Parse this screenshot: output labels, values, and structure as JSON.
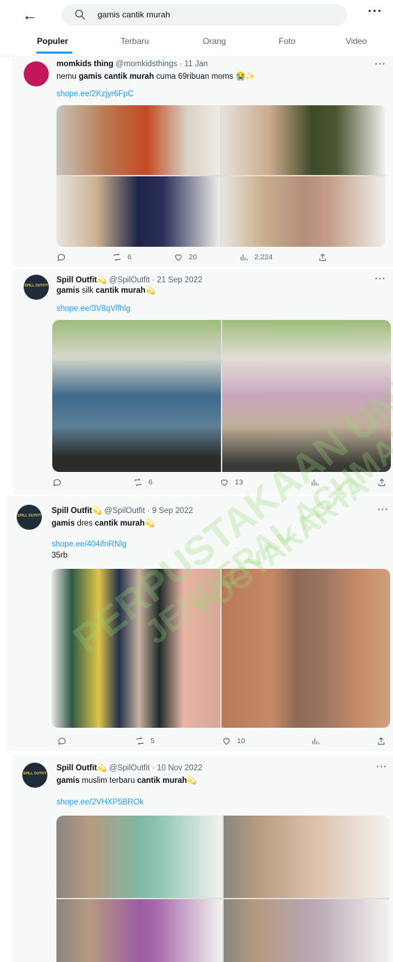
{
  "search": {
    "query": "gamis cantik murah"
  },
  "tabs": [
    "Populer",
    "Terbaru",
    "Orang",
    "Foto",
    "Video"
  ],
  "posts": [
    {
      "name": "momkids thing",
      "handle": "@momkidsthings",
      "date": "· 11 Jan",
      "text_pre": "nemu ",
      "text_bold": "gamis cantik murah",
      "text_post": " cuma 69ribuan moms 😭✨",
      "link": "shope.ee/2Kzjyr6FpC",
      "replies": "",
      "retweets": "6",
      "likes": "20",
      "views": "2.224"
    },
    {
      "name": "Spill Outfit",
      "badge": "💫",
      "handle": "@SpilOutfit",
      "date": "· 21 Sep 2022",
      "text": [
        {
          "b": "gamis"
        },
        {
          "t": " silk "
        },
        {
          "b": "cantik murah"
        },
        {
          "t": "💫"
        }
      ],
      "link": "shope.ee/3V8qVlfhlg",
      "retweets": "6",
      "likes": "13"
    },
    {
      "name": "Spill Outfit",
      "badge": "💫",
      "handle": "@SpilOutfit",
      "date": "· 9 Sep 2022",
      "text_b1": "gamis",
      "text_t1": " dres ",
      "text_b2": "cantik murah",
      "text_t2": "💫",
      "link": "shope.ee/404ifnRNlg",
      "extra": "35rb",
      "retweets": "5",
      "likes": "10"
    },
    {
      "name": "Spill Outfit",
      "badge": "💫",
      "handle": "@SpilOutfit",
      "date": "· 10 Nov 2022",
      "text_b1": "gamis",
      "text_t1": " muslim terbaru ",
      "text_b2": "cantik murah",
      "text_t2": "💫",
      "link": "shope.ee/2VHXP5BROk"
    }
  ],
  "watermark": {
    "lines": [
      "PERPUSTAKAAN UNIVERSITAS",
      "JENDERAL ACHMAD YANI",
      "YOGYAKARTA"
    ],
    "color": "#96dc78"
  },
  "avatar_labels": {
    "spill": "SPILL OUTFIT"
  }
}
